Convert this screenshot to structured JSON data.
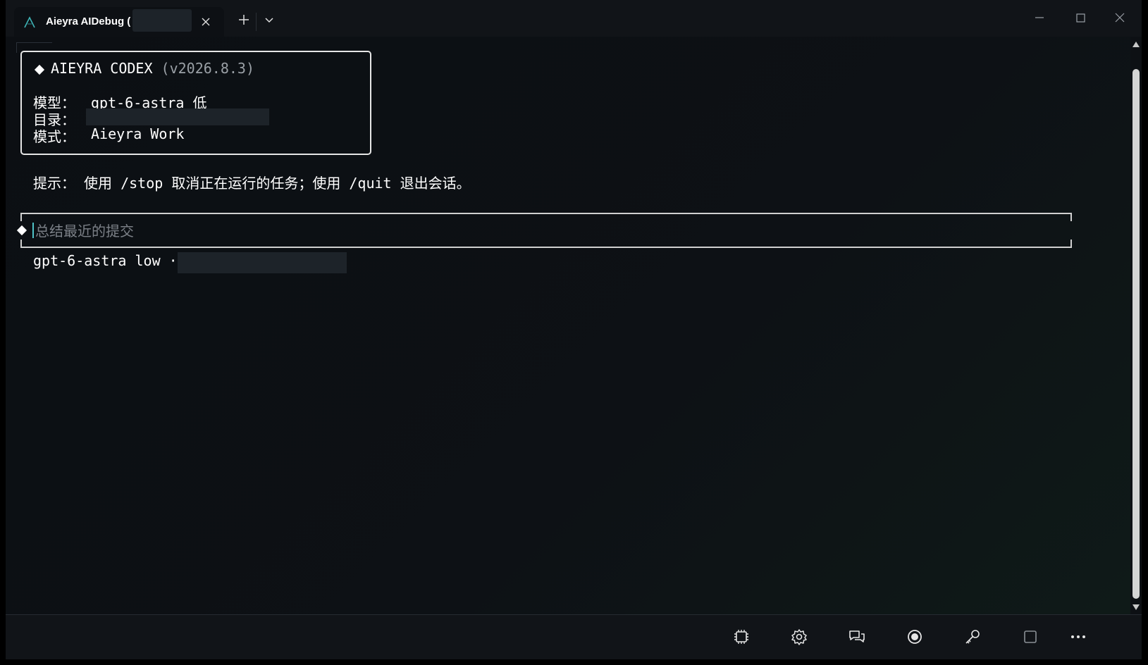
{
  "colors": {
    "background": "#0d1014",
    "titlebar": "#111418",
    "text": "#ffffff",
    "muted": "#9aa0a6",
    "accent": "#4fc3c7"
  },
  "tab": {
    "title": "Aieyra AIDebug (",
    "icon": "aieyra-logo-icon"
  },
  "header": {
    "title": "AIEYRA CODEX",
    "version": "(v2026.8.3)",
    "model_label": "模型：",
    "model_value": "gpt-6-astra 低",
    "dir_label": "目录：",
    "mode_label": "模式：",
    "mode_value": "Aieyra Work"
  },
  "tip": "提示： 使用 /stop 取消正在运行的任务；使用 /quit 退出会话。",
  "prompt": {
    "placeholder": "总结最近的提交",
    "value": ""
  },
  "status": "gpt-6-astra low ·",
  "bottombar": {
    "icons": [
      "cpu-icon",
      "settings-icon",
      "chat-icon",
      "record-icon",
      "key-icon",
      "square-icon",
      "more-icon"
    ]
  }
}
